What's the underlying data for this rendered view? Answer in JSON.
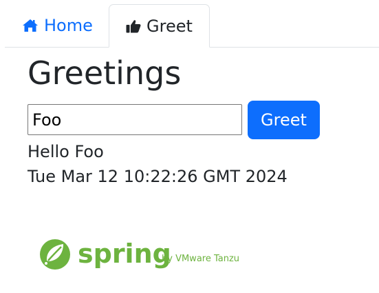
{
  "tabs": [
    {
      "label": "Home",
      "icon": "home-icon",
      "color": "#0d6efd"
    },
    {
      "label": "Greet",
      "icon": "thumbs-up-icon",
      "active": true
    }
  ],
  "page": {
    "title": "Greetings"
  },
  "form": {
    "name_value": "Foo",
    "button_label": "Greet",
    "accent": "#0d6efd"
  },
  "result": {
    "message": "Hello Foo",
    "timestamp": "Tue Mar 12 10:22:26 GMT 2024"
  },
  "logo": {
    "wordmark": "spring",
    "tagline": "by VMware Tanzu",
    "color": "#6db33f"
  }
}
